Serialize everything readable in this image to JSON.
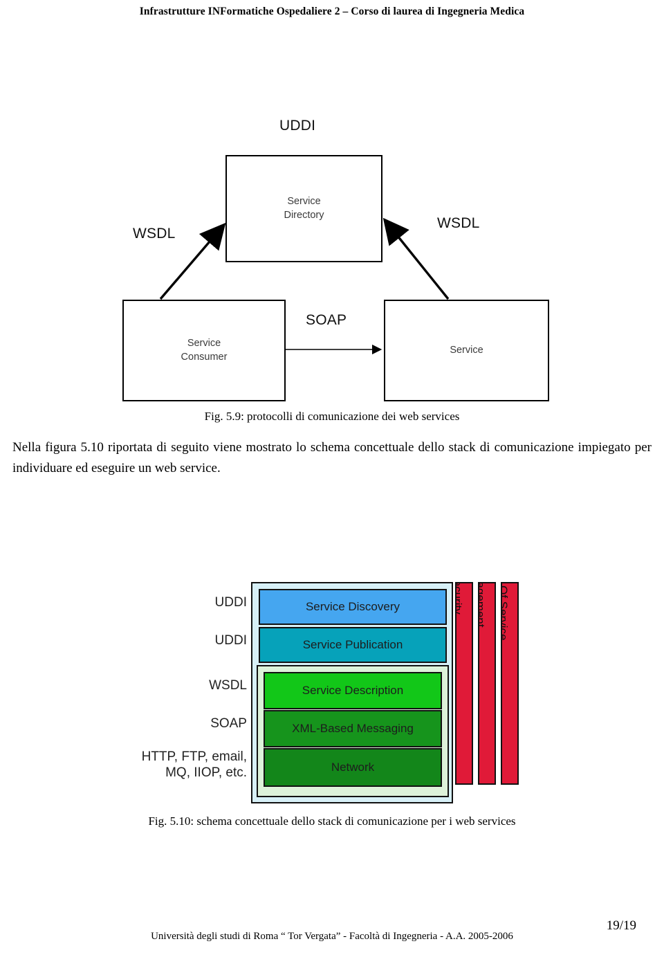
{
  "header": {
    "running_title": "Infrastrutture INFormatiche Ospedaliere 2 – Corso di laurea di Ingegneria Medica"
  },
  "figure_5_9": {
    "caption": "Fig. 5.9: protocolli di comunicazione dei web services",
    "nodes": {
      "directory": "Service\nDirectory",
      "consumer": "Service\nConsumer",
      "service": "Service"
    },
    "protocol_labels": {
      "uddi": "UDDI",
      "wsdl_left": "WSDL",
      "wsdl_right": "WSDL",
      "soap": "SOAP"
    }
  },
  "body_text": {
    "paragraph": "Nella figura 5.10 riportata di seguito viene mostrato lo schema concettuale dello stack di comunicazione impiegato per individuare ed eseguire un web service."
  },
  "figure_5_10": {
    "caption": "Fig. 5.10: schema concettuale dello stack di comunicazione per i web services",
    "stack_layers": [
      {
        "label": "Service Discovery",
        "technology": "UDDI",
        "color": "#45a6f0"
      },
      {
        "label": "Service Publication",
        "technology": "UDDI",
        "color": "#06a2ba"
      },
      {
        "label": "Service Description",
        "technology": "WSDL",
        "color": "#12c718"
      },
      {
        "label": "XML-Based Messaging",
        "technology": "SOAP",
        "color": "#16941c"
      },
      {
        "label": "Network",
        "technology": "HTTP, FTP, email,\nMQ, IIOP, etc.",
        "color": "#13861a"
      }
    ],
    "cross_cutting_bars": [
      {
        "label": "Security",
        "color": "#e01a38"
      },
      {
        "label": "Management",
        "color": "#e01a38"
      },
      {
        "label": "Quality Of Service",
        "color": "#e01a38"
      }
    ]
  },
  "footer": {
    "institution": "Università degli studi di Roma “ Tor Vergata” - Facoltà di Ingegneria - A.A. 2005-2006",
    "page_number": "19/19"
  }
}
